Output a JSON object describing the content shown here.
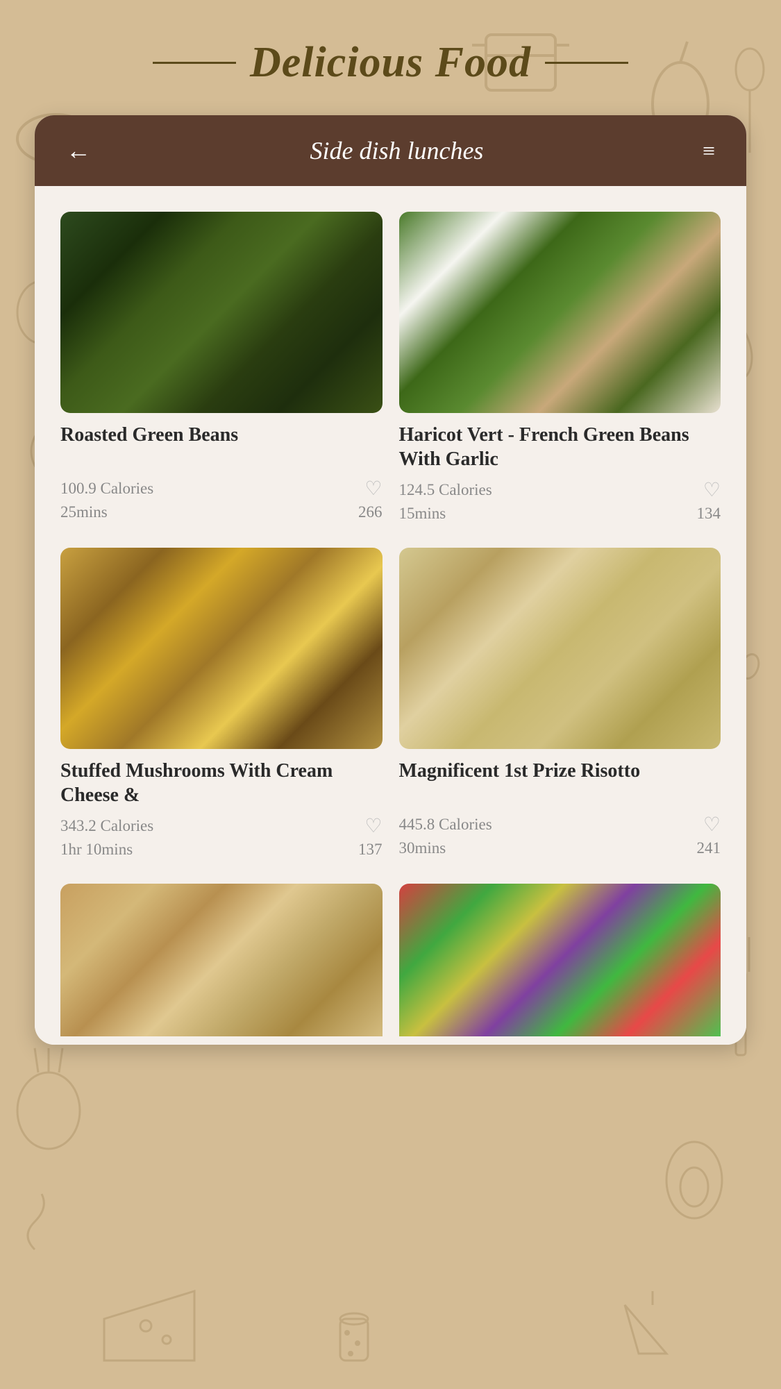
{
  "app": {
    "title": "Delicious Food",
    "background_color": "#d4bc95"
  },
  "header": {
    "title": "Side dish lunches",
    "back_label": "←",
    "filter_label": "≡"
  },
  "recipes": [
    {
      "id": "roasted-green-beans",
      "title": "Roasted Green Beans",
      "calories": "100.9 Calories",
      "time": "25mins",
      "likes": "266",
      "image_class": "img-roasted-beans"
    },
    {
      "id": "haricot-vert",
      "title": "Haricot Vert - French Green Beans With Garlic",
      "calories": "124.5 Calories",
      "time": "15mins",
      "likes": "134",
      "image_class": "img-haricot-vert"
    },
    {
      "id": "stuffed-mushrooms",
      "title": "Stuffed Mushrooms With Cream Cheese &",
      "calories": "343.2 Calories",
      "time": "1hr 10mins",
      "likes": "137",
      "image_class": "img-stuffed-mushrooms"
    },
    {
      "id": "risotto",
      "title": "Magnificent 1st Prize Risotto",
      "calories": "445.8 Calories",
      "time": "30mins",
      "likes": "241",
      "image_class": "img-risotto"
    }
  ],
  "partial_recipes": [
    {
      "id": "pasta",
      "image_class": "img-pasta"
    },
    {
      "id": "salad",
      "image_class": "img-salad"
    }
  ]
}
